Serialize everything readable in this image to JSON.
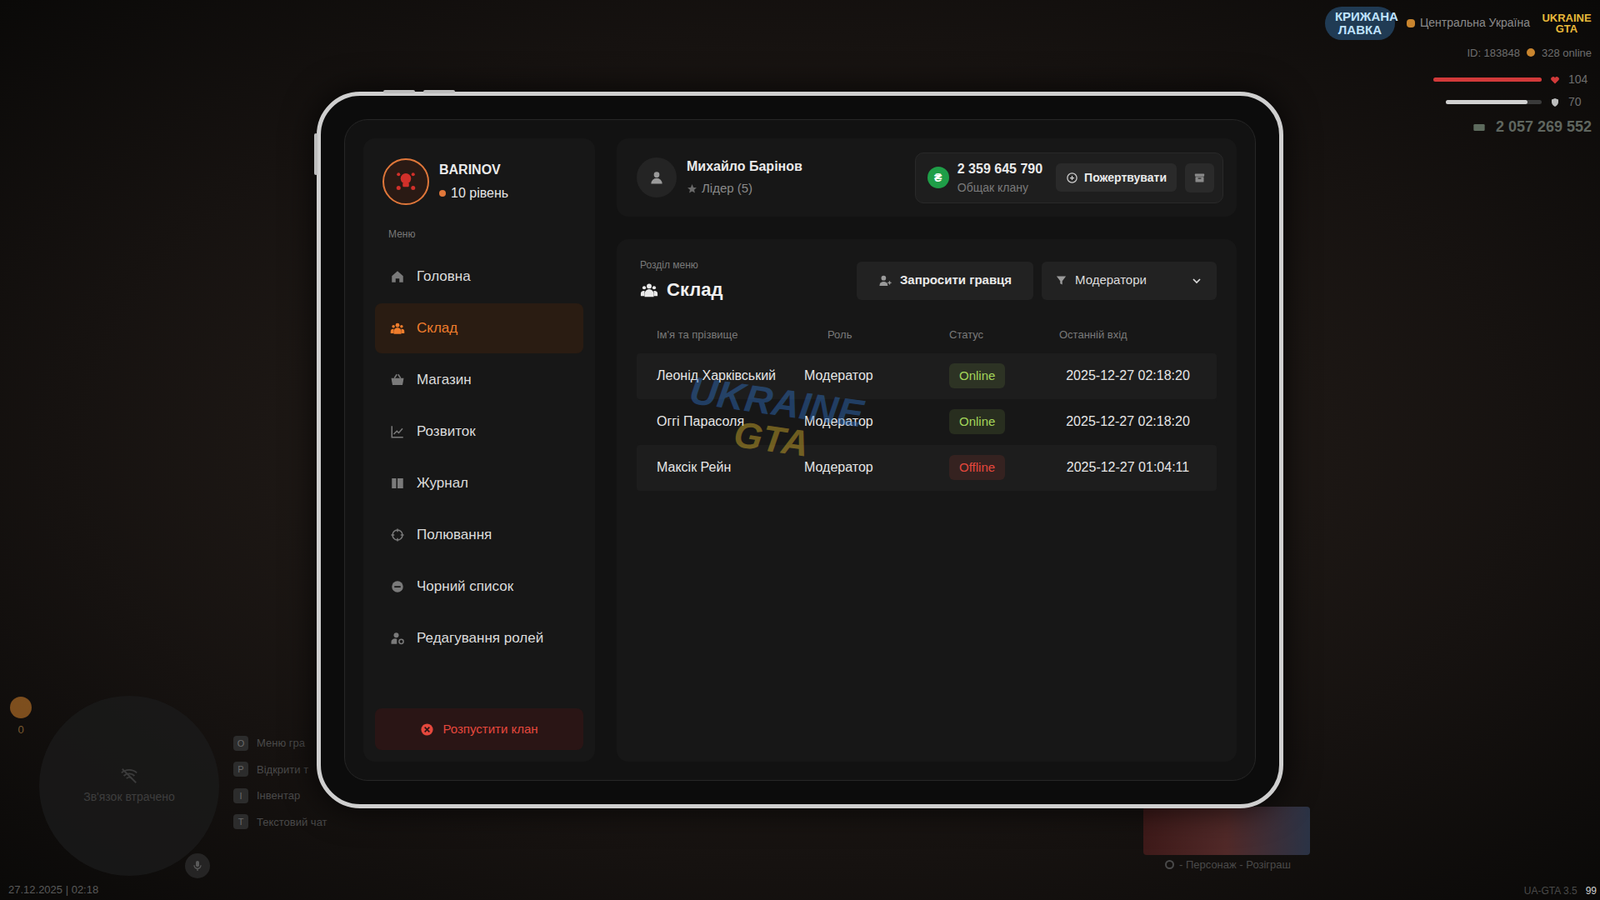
{
  "hud": {
    "logo": "КРИЖАНА ЛАВКА",
    "server": "Центральна Україна",
    "brand": "UKRAINE GTA",
    "player_id": "ID: 183848",
    "online": "328 online",
    "health": {
      "value": "104",
      "level": 1
    },
    "armor": {
      "value": "70",
      "level": 0.85
    },
    "cash": "2 057 269 552",
    "wanted": "0",
    "minimap": "Зв'язок втрачено",
    "hotkeys": [
      {
        "key": "O",
        "label": "Меню гра"
      },
      {
        "key": "P",
        "label": "Відкрити т"
      },
      {
        "key": "I",
        "label": "Інвентар"
      },
      {
        "key": "T",
        "label": "Текстовий чат"
      }
    ],
    "event_hint": "- Персонаж - Розіграш",
    "datetime": "27.12.2025 | 02:18",
    "version": "UA-GTA 3.5",
    "fps": "99"
  },
  "tablet": {
    "profile": {
      "name": "BARINOV",
      "level": "10 рівень"
    },
    "menu_label": "Меню",
    "menu": [
      {
        "label": "Головна",
        "selected": false
      },
      {
        "label": "Склад",
        "selected": true
      },
      {
        "label": "Магазин",
        "selected": false
      },
      {
        "label": "Розвиток",
        "selected": false
      },
      {
        "label": "Журнал",
        "selected": false
      },
      {
        "label": "Полювання",
        "selected": false
      },
      {
        "label": "Чорний список",
        "selected": false
      },
      {
        "label": "Редагування ролей",
        "selected": false
      }
    ],
    "disband": "Розпустити клан",
    "user": {
      "name": "Михайло Барінов",
      "rank": "Лідер (5)"
    },
    "treasury": {
      "currency": "₴",
      "amount": "2 359 645 790",
      "label": "Общак клану"
    },
    "donate": "Пожертвувати",
    "section": {
      "caption": "Розділ меню",
      "title": "Склад"
    },
    "invite": "Запросити гравця",
    "filter": "Модератори",
    "table": {
      "columns": [
        "Ім'я та прізвище",
        "Роль",
        "Статус",
        "Останній вхід"
      ],
      "rows": [
        {
          "name": "Леонід Харківський",
          "role": "Модератор",
          "status": "Online",
          "color": "#a3d65a",
          "last_login": "2025-12-27 02:18:20"
        },
        {
          "name": "Оггі Парасоля",
          "role": "Модератор",
          "status": "Online",
          "color": "#a3d65a",
          "last_login": "2025-12-27 02:18:20"
        },
        {
          "name": "Максік Рейн",
          "role": "Модератор",
          "status": "Offline",
          "color": "#e5483d",
          "last_login": "2025-12-27 01:04:11"
        }
      ]
    },
    "watermark": {
      "line1": "UKRAINE",
      "line2": "GTA"
    }
  }
}
